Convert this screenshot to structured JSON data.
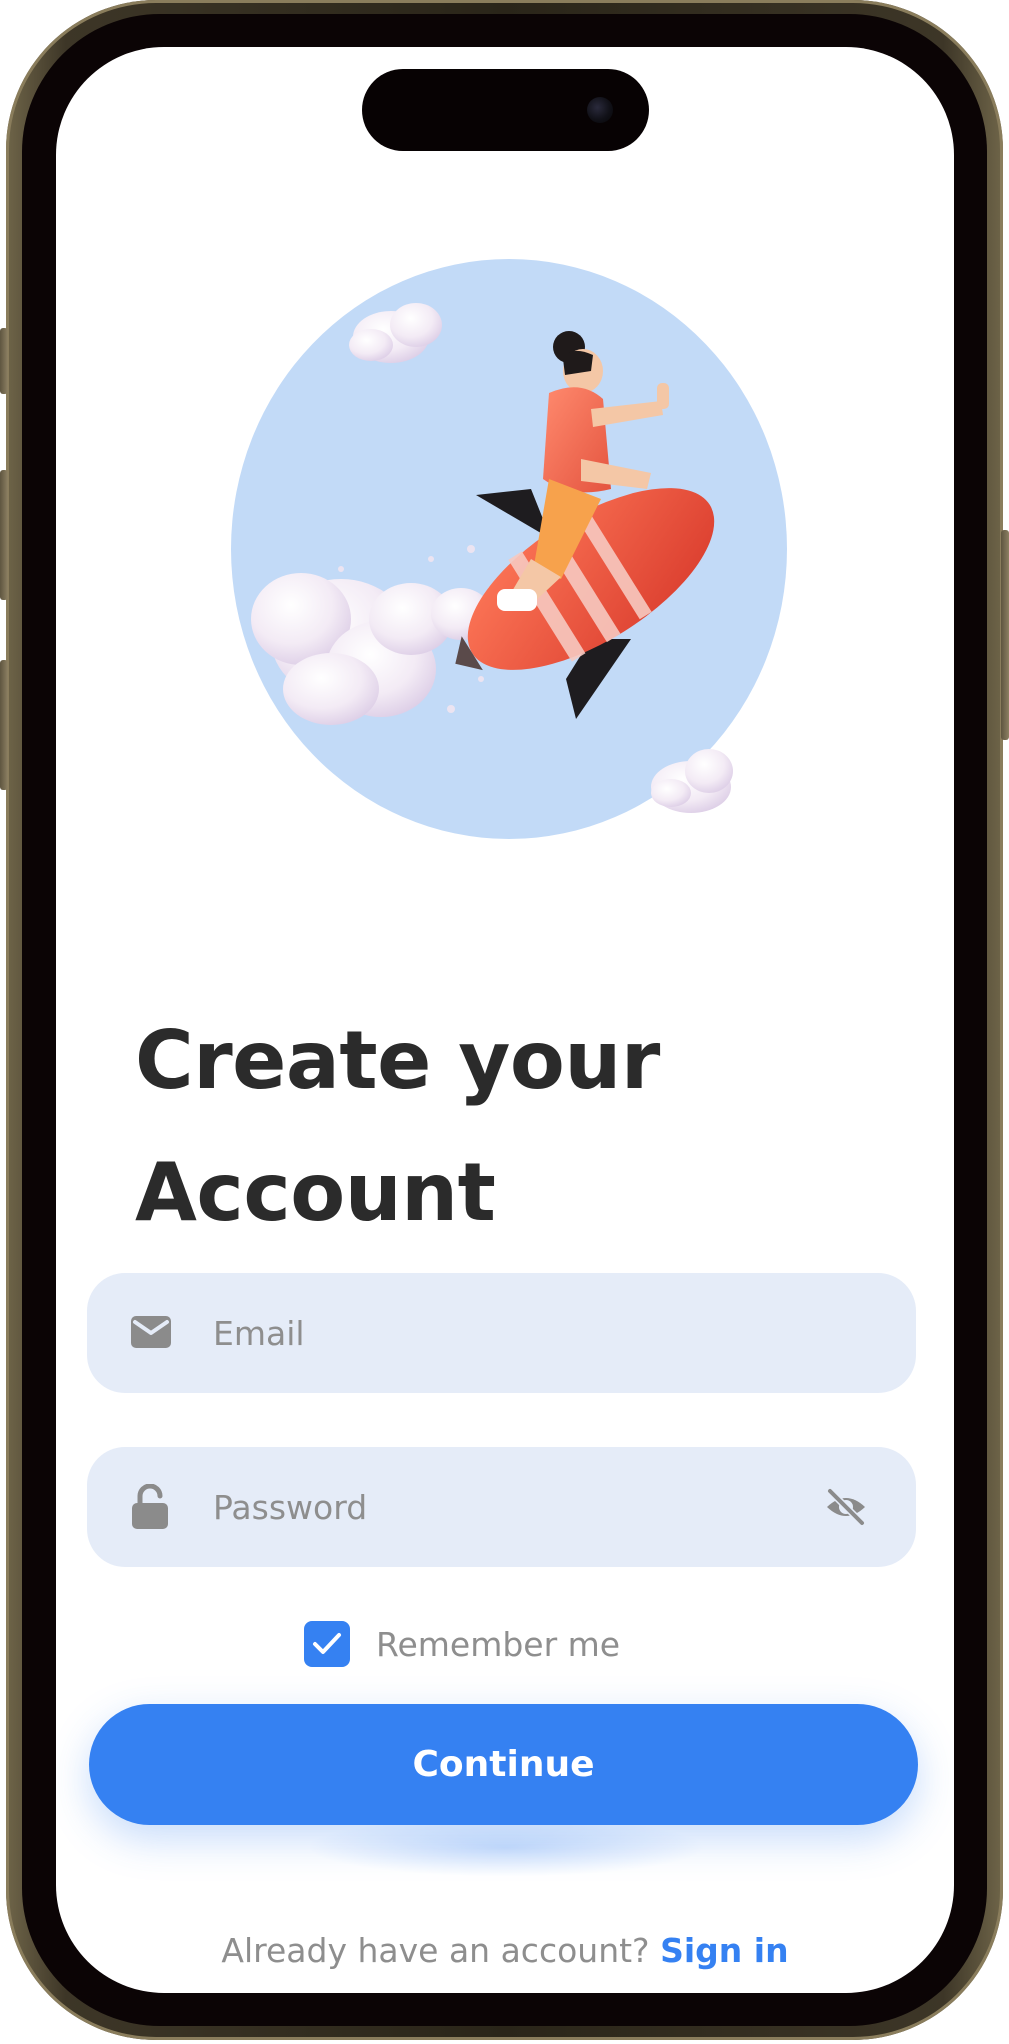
{
  "signup": {
    "title_line1": "Create your",
    "title_line2": "Account",
    "email": {
      "placeholder": "Email",
      "value": ""
    },
    "password": {
      "placeholder": "Password",
      "value": ""
    },
    "remember": {
      "label": "Remember me",
      "checked": true
    },
    "continue_label": "Continue",
    "footer_text": "Already have an account?",
    "signin_label": "Sign in"
  },
  "icons": {
    "email": "envelope-icon",
    "password": "lock-icon",
    "toggle_visibility": "eye-off-icon",
    "checkbox": "check-icon"
  },
  "colors": {
    "accent": "#3581f2",
    "field_bg": "#e5ecf8",
    "title": "#2b2b2b",
    "muted": "#8e8e8e",
    "hero_circle": "#c2daf7"
  }
}
